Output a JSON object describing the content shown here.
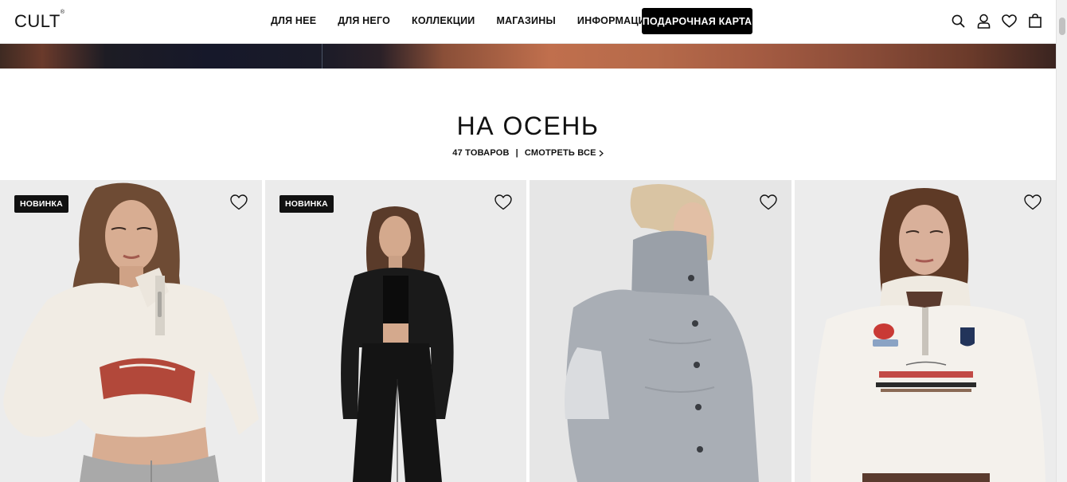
{
  "header": {
    "logo": "CULT",
    "logo_mark": "®",
    "nav": [
      {
        "label": "ДЛЯ НЕЕ"
      },
      {
        "label": "ДЛЯ НЕГО"
      },
      {
        "label": "КОЛЛЕКЦИИ"
      },
      {
        "label": "МАГАЗИНЫ"
      },
      {
        "label": "ИНФОРМАЦИЯ"
      }
    ],
    "gift_card": "ПОДАРОЧНАЯ КАРТА",
    "icons": [
      "search-icon",
      "account-icon",
      "wishlist-icon",
      "bag-icon"
    ]
  },
  "section": {
    "title": "НА ОСЕНЬ",
    "count": "47 ТОВАРОВ",
    "separator": "|",
    "see_all": "СМОТРЕТЬ ВСЕ"
  },
  "products": [
    {
      "badge": "НОВИНКА",
      "icon": "heart-icon"
    },
    {
      "badge": "НОВИНКА",
      "icon": "heart-icon"
    },
    {
      "badge": "",
      "icon": "heart-icon"
    },
    {
      "badge": "",
      "icon": "heart-icon"
    }
  ],
  "colors": {
    "accent": "#000000",
    "background": "#ffffff",
    "photo_background": "#e9e9e9"
  }
}
